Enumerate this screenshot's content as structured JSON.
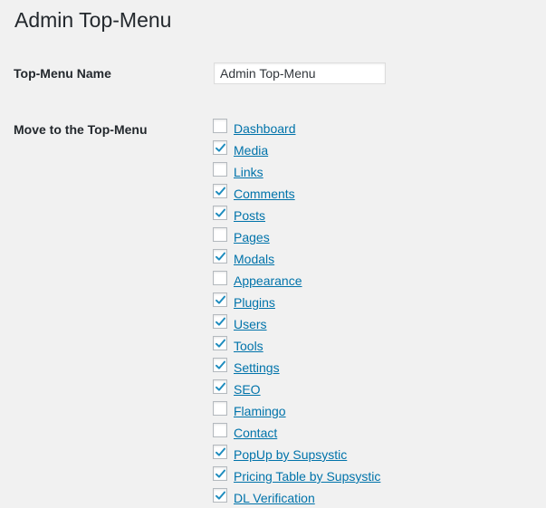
{
  "page": {
    "title": "Admin Top-Menu"
  },
  "form": {
    "name_label": "Top-Menu Name",
    "name_value": "Admin Top-Menu",
    "move_label": "Move to the Top-Menu"
  },
  "colors": {
    "link": "#0073aa",
    "check": "#1e8cbe",
    "background": "#f1f1f1"
  },
  "menu_items": [
    {
      "label": "Dashboard",
      "checked": false
    },
    {
      "label": "Media",
      "checked": true
    },
    {
      "label": "Links",
      "checked": false
    },
    {
      "label": "Comments",
      "checked": true
    },
    {
      "label": "Posts",
      "checked": true
    },
    {
      "label": "Pages",
      "checked": false
    },
    {
      "label": "Modals",
      "checked": true
    },
    {
      "label": "Appearance",
      "checked": false
    },
    {
      "label": "Plugins",
      "checked": true
    },
    {
      "label": "Users",
      "checked": true
    },
    {
      "label": "Tools",
      "checked": true
    },
    {
      "label": "Settings",
      "checked": true
    },
    {
      "label": "SEO",
      "checked": true
    },
    {
      "label": "Flamingo",
      "checked": false
    },
    {
      "label": "Contact",
      "checked": false
    },
    {
      "label": "PopUp by Supsystic",
      "checked": true
    },
    {
      "label": "Pricing Table by Supsystic",
      "checked": true
    },
    {
      "label": "DL Verification",
      "checked": true
    }
  ]
}
